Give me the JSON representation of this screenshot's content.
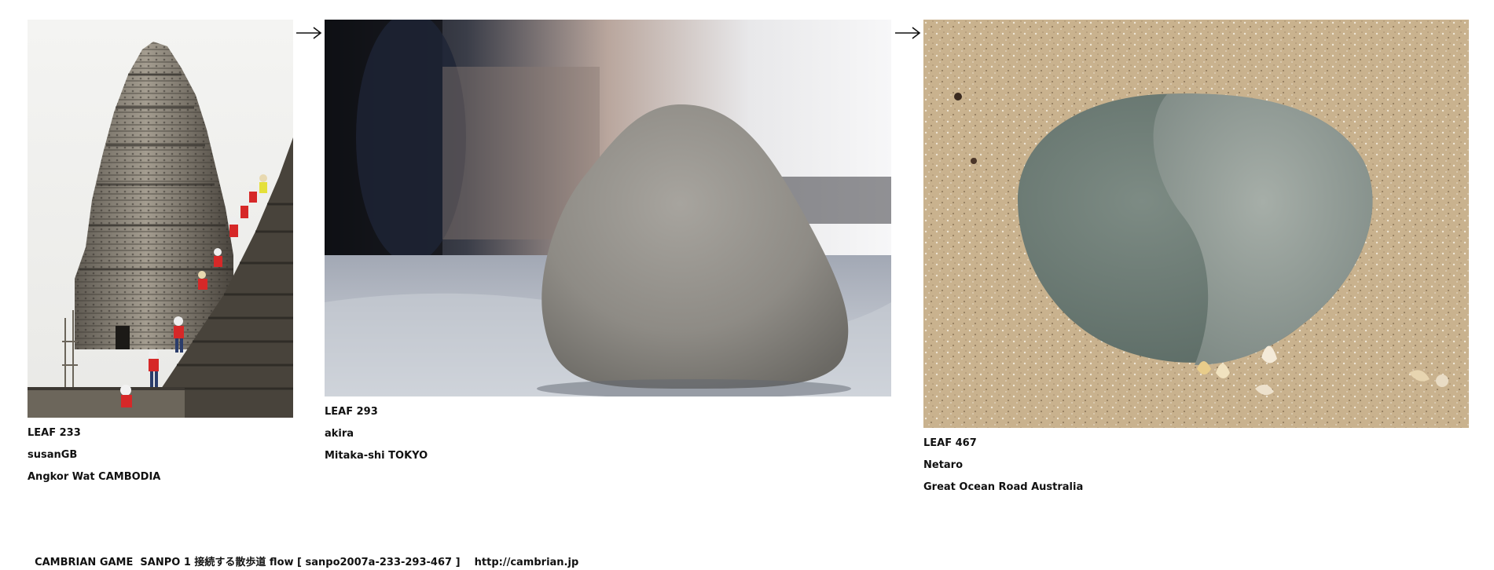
{
  "leaves": [
    {
      "id": "LEAF 233",
      "author": "susanGB",
      "place": "Angkor Wat CAMBODIA",
      "photo_subject": "stone temple tower with people in red climbing steps"
    },
    {
      "id": "LEAF 293",
      "author": "akira",
      "place": "Mitaka-shi TOKYO",
      "photo_subject": "rounded grey stone on pale surface"
    },
    {
      "id": "LEAF 467",
      "author": "Netaro",
      "place": "Great Ocean Road Australia",
      "photo_subject": "two-tone green-grey pebble on sand with small shells"
    }
  ],
  "arrows": [
    "arrow-right-icon",
    "arrow-right-icon"
  ],
  "footer": {
    "text": "CAMBRIAN GAME  SANPO 1 接続する散歩道 flow [ sanpo2007a-233-293-467 ]",
    "url": "http://cambrian.jp"
  }
}
